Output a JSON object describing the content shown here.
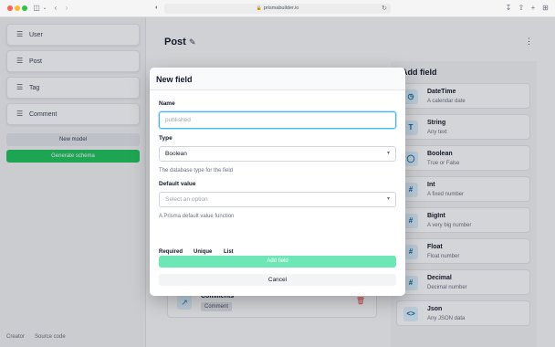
{
  "browser": {
    "url": "prismabuilder.io"
  },
  "sidebar": {
    "models": [
      {
        "label": "User"
      },
      {
        "label": "Post"
      },
      {
        "label": "Tag"
      },
      {
        "label": "Comment"
      }
    ],
    "new_model_label": "New model",
    "generate_label": "Generate schema",
    "footer": {
      "creator": "Creator",
      "source": "Source code"
    }
  },
  "main": {
    "title": "Post",
    "field_card": {
      "name": "Comments",
      "type": "Comment"
    }
  },
  "add_panel": {
    "title": "Add field",
    "types": [
      {
        "name": "DateTime",
        "desc": "A calendar date",
        "icon": "clock-icon"
      },
      {
        "name": "String",
        "desc": "Any text",
        "icon": "text-icon"
      },
      {
        "name": "Boolean",
        "desc": "True or False",
        "icon": "toggle-icon"
      },
      {
        "name": "Int",
        "desc": "A fixed number",
        "icon": "hash-icon"
      },
      {
        "name": "BigInt",
        "desc": "A very big number",
        "icon": "hash-icon"
      },
      {
        "name": "Float",
        "desc": "Float number",
        "icon": "hash-icon"
      },
      {
        "name": "Decimal",
        "desc": "Decimal number",
        "icon": "hash-icon"
      },
      {
        "name": "Json",
        "desc": "Any JSON data",
        "icon": "code-icon"
      }
    ]
  },
  "modal": {
    "title": "New field",
    "name_label": "Name",
    "name_placeholder": "published",
    "type_label": "Type",
    "type_value": "Boolean",
    "type_help": "The database type for the field",
    "default_label": "Default value",
    "default_placeholder": "Select an option",
    "default_help": "A Prisma default value function",
    "required_label": "Required",
    "unique_label": "Unique",
    "list_label": "List",
    "add_label": "Add field",
    "cancel_label": "Cancel"
  },
  "colors": {
    "accent_green": "#22c55e",
    "add_button_disabled": "#6ee7b7",
    "focus_ring": "#38bdf8",
    "delete_red": "#ef4444"
  }
}
